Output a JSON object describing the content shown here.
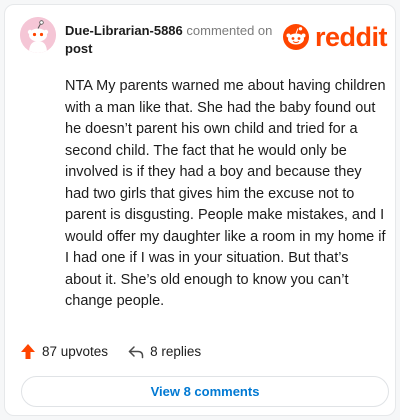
{
  "comment": {
    "username": "Due-Librarian-5886",
    "commented_on": "commented on",
    "target": "post",
    "body": "NTA My parents warned me about having children with a man like that. She had the baby found out he doesn’t parent his own child and tried for a second child. The fact that he would only be involved is if they had a boy and because they had two girls that gives him the excuse not to parent is disgusting. People make mistakes, and I would offer my daughter like a room in my home if I had one if I was in your situation. But that’s about it. She’s old enough to know you can’t change people.",
    "upvotes": "87 upvotes",
    "replies": "8 replies",
    "view_comments_label": "View 8 comments"
  },
  "brand": {
    "wordmark": "reddit",
    "accent": "#ff4500",
    "link_color": "#0079d3"
  },
  "icons": {
    "avatar": "snoo-avatar-icon",
    "logo": "reddit-snoo-icon",
    "upvote": "upvote-arrow-icon",
    "reply": "reply-arrow-icon"
  }
}
